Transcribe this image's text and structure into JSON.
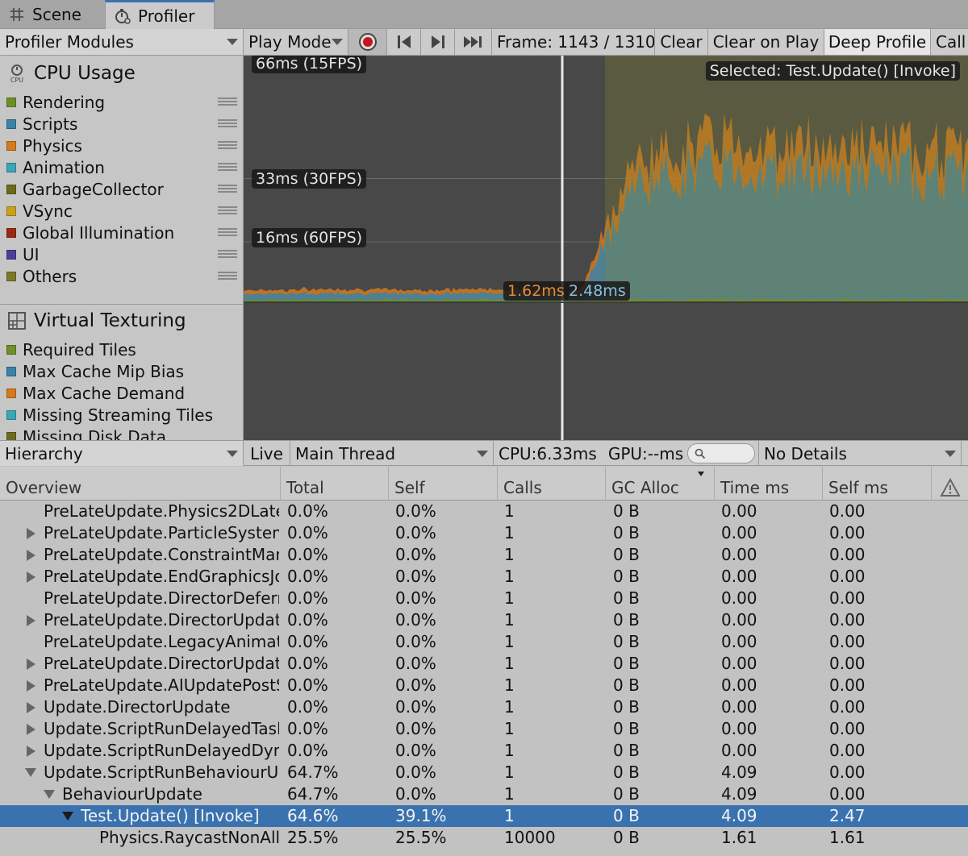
{
  "tabs": {
    "scene": "Scene",
    "profiler": "Profiler"
  },
  "toolbar": {
    "modules": "Profiler Modules",
    "play_mode": "Play Mode",
    "frame": "Frame: 1143 / 1310",
    "clear": "Clear",
    "clear_on_play": "Clear on Play",
    "deep_profile": "Deep Profile",
    "call": "Call"
  },
  "cpu_module": {
    "title": "CPU Usage",
    "icon_text": "CPU",
    "legend": [
      {
        "label": "Rendering",
        "color": "#6c8f27"
      },
      {
        "label": "Scripts",
        "color": "#3b82a8"
      },
      {
        "label": "Physics",
        "color": "#d67a1e"
      },
      {
        "label": "Animation",
        "color": "#3aa7b5"
      },
      {
        "label": "GarbageCollector",
        "color": "#6b6b1e"
      },
      {
        "label": "VSync",
        "color": "#c9a21c"
      },
      {
        "label": "Global Illumination",
        "color": "#9a2a12"
      },
      {
        "label": "UI",
        "color": "#4f3c9a"
      },
      {
        "label": "Others",
        "color": "#7a7a2a"
      }
    ]
  },
  "vt_module": {
    "title": "Virtual Texturing",
    "legend": [
      {
        "label": "Required Tiles",
        "color": "#6c8f27"
      },
      {
        "label": "Max Cache Mip Bias",
        "color": "#3b82a8"
      },
      {
        "label": "Max Cache Demand",
        "color": "#d67a1e"
      },
      {
        "label": "Missing Streaming Tiles",
        "color": "#3aa7b5"
      },
      {
        "label": "Missing Disk Data",
        "color": "#6b6b1e"
      }
    ]
  },
  "chart": {
    "label_66": "66ms (15FPS)",
    "label_33": "33ms (30FPS)",
    "label_16": "16ms (60FPS)",
    "selected": "Selected: Test.Update() [Invoke]",
    "marker_left": "1.62ms",
    "marker_right": "2.48ms"
  },
  "chart_data": {
    "type": "area",
    "title": "",
    "xlabel": "",
    "ylabel": "",
    "ylim": [
      0,
      66
    ],
    "reference_lines": [
      "66ms (15FPS)",
      "33ms (30FPS)",
      "16ms (60FPS)"
    ],
    "series": [
      {
        "name": "Rendering",
        "values_ms": [
          0.5,
          0.5,
          0.6,
          0.5,
          0.5,
          0.6,
          0.5,
          0.5,
          0.5,
          0.5,
          0.5,
          0.5,
          0.5,
          0.5,
          0.5,
          0.5
        ]
      },
      {
        "name": "Scripts",
        "values_ms": [
          1.6,
          1.6,
          1.7,
          1.6,
          1.6,
          1.7,
          1.6,
          1.62,
          30,
          34,
          36,
          34,
          35,
          34,
          34,
          33
        ]
      },
      {
        "name": "Physics",
        "values_ms": [
          1.0,
          1.0,
          1.1,
          1.0,
          1.0,
          1.1,
          1.0,
          1.0,
          6,
          7,
          8,
          7,
          7,
          7,
          7,
          7
        ]
      }
    ],
    "x": [
      1,
      2,
      3,
      4,
      5,
      6,
      7,
      8,
      9,
      10,
      11,
      12,
      13,
      14,
      15,
      16
    ]
  },
  "hierarchy_toolbar": {
    "view": "Hierarchy",
    "live": "Live",
    "thread": "Main Thread",
    "cpu": "CPU:6.33ms",
    "gpu": "GPU:--ms",
    "details": "No Details"
  },
  "table": {
    "columns": [
      "Overview",
      "Total",
      "Self",
      "Calls",
      "GC Alloc",
      "Time ms",
      "Self ms"
    ],
    "rows": [
      {
        "name": "PreLateUpdate.Physics2DLate",
        "total": "0.0%",
        "self": "0.0%",
        "calls": "1",
        "gc": "0 B",
        "time": "0.00",
        "selfms": "0.00",
        "indent": 0,
        "expander": "none"
      },
      {
        "name": "PreLateUpdate.ParticleSystem",
        "total": "0.0%",
        "self": "0.0%",
        "calls": "1",
        "gc": "0 B",
        "time": "0.00",
        "selfms": "0.00",
        "indent": 0,
        "expander": "right"
      },
      {
        "name": "PreLateUpdate.ConstraintMan",
        "total": "0.0%",
        "self": "0.0%",
        "calls": "1",
        "gc": "0 B",
        "time": "0.00",
        "selfms": "0.00",
        "indent": 0,
        "expander": "right"
      },
      {
        "name": "PreLateUpdate.EndGraphicsJo",
        "total": "0.0%",
        "self": "0.0%",
        "calls": "1",
        "gc": "0 B",
        "time": "0.00",
        "selfms": "0.00",
        "indent": 0,
        "expander": "right"
      },
      {
        "name": "PreLateUpdate.DirectorDeferre",
        "total": "0.0%",
        "self": "0.0%",
        "calls": "1",
        "gc": "0 B",
        "time": "0.00",
        "selfms": "0.00",
        "indent": 0,
        "expander": "none"
      },
      {
        "name": "PreLateUpdate.DirectorUpdate",
        "total": "0.0%",
        "self": "0.0%",
        "calls": "1",
        "gc": "0 B",
        "time": "0.00",
        "selfms": "0.00",
        "indent": 0,
        "expander": "right"
      },
      {
        "name": "PreLateUpdate.LegacyAnimati",
        "total": "0.0%",
        "self": "0.0%",
        "calls": "1",
        "gc": "0 B",
        "time": "0.00",
        "selfms": "0.00",
        "indent": 0,
        "expander": "none"
      },
      {
        "name": "PreLateUpdate.DirectorUpdate",
        "total": "0.0%",
        "self": "0.0%",
        "calls": "1",
        "gc": "0 B",
        "time": "0.00",
        "selfms": "0.00",
        "indent": 0,
        "expander": "right"
      },
      {
        "name": "PreLateUpdate.AIUpdatePostS",
        "total": "0.0%",
        "self": "0.0%",
        "calls": "1",
        "gc": "0 B",
        "time": "0.00",
        "selfms": "0.00",
        "indent": 0,
        "expander": "right"
      },
      {
        "name": "Update.DirectorUpdate",
        "total": "0.0%",
        "self": "0.0%",
        "calls": "1",
        "gc": "0 B",
        "time": "0.00",
        "selfms": "0.00",
        "indent": 0,
        "expander": "right"
      },
      {
        "name": "Update.ScriptRunDelayedTask",
        "total": "0.0%",
        "self": "0.0%",
        "calls": "1",
        "gc": "0 B",
        "time": "0.00",
        "selfms": "0.00",
        "indent": 0,
        "expander": "right"
      },
      {
        "name": "Update.ScriptRunDelayedDyna",
        "total": "0.0%",
        "self": "0.0%",
        "calls": "1",
        "gc": "0 B",
        "time": "0.00",
        "selfms": "0.00",
        "indent": 0,
        "expander": "right"
      },
      {
        "name": "Update.ScriptRunBehaviourUp",
        "total": "64.7%",
        "self": "0.0%",
        "calls": "1",
        "gc": "0 B",
        "time": "4.09",
        "selfms": "0.00",
        "indent": 0,
        "expander": "down"
      },
      {
        "name": "BehaviourUpdate",
        "total": "64.7%",
        "self": "0.0%",
        "calls": "1",
        "gc": "0 B",
        "time": "4.09",
        "selfms": "0.00",
        "indent": 1,
        "expander": "down"
      },
      {
        "name": "Test.Update() [Invoke]",
        "total": "64.6%",
        "self": "39.1%",
        "calls": "1",
        "gc": "0 B",
        "time": "4.09",
        "selfms": "2.47",
        "indent": 2,
        "expander": "down",
        "selected": true
      },
      {
        "name": "Physics.RaycastNonAll",
        "total": "25.5%",
        "self": "25.5%",
        "calls": "10000",
        "gc": "0 B",
        "time": "1.61",
        "selfms": "1.61",
        "indent": 3,
        "expander": "none"
      }
    ]
  },
  "icons": {
    "scene_tab": "grid-icon",
    "profiler_tab": "profiler-stopwatch-icon",
    "record": "record-icon",
    "prev": "step-back-icon",
    "next": "step-forward-icon",
    "last": "fast-forward-icon",
    "search": "search-icon",
    "warning": "warning-icon",
    "virtual_texturing": "tiles-icon"
  }
}
